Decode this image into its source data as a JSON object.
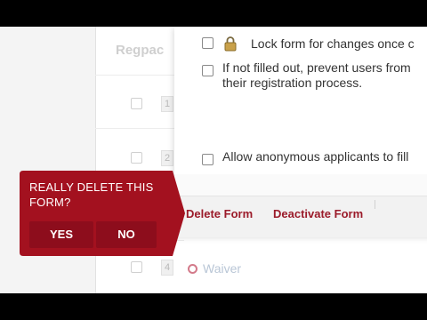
{
  "list": {
    "header": "Regpac",
    "rows": [
      {
        "num": "1"
      },
      {
        "num": "2"
      },
      {
        "num": "4",
        "label": "Waiver"
      }
    ]
  },
  "settings": {
    "options": [
      {
        "text": "Lock form for changes once c"
      },
      {
        "text_line1": "If not filled out, prevent users from",
        "text_line2": "their registration process."
      },
      {
        "text": "Allow anonymous applicants to fill"
      }
    ],
    "actions": {
      "delete_label": "Delete Form",
      "deactivate_label": "Deactivate Form"
    }
  },
  "confirm": {
    "question": "REALLY DELETE THIS FORM?",
    "yes_label": "YES",
    "no_label": "NO"
  },
  "colors": {
    "brand_red": "#a3111f",
    "link_red": "#9b1b2a"
  }
}
